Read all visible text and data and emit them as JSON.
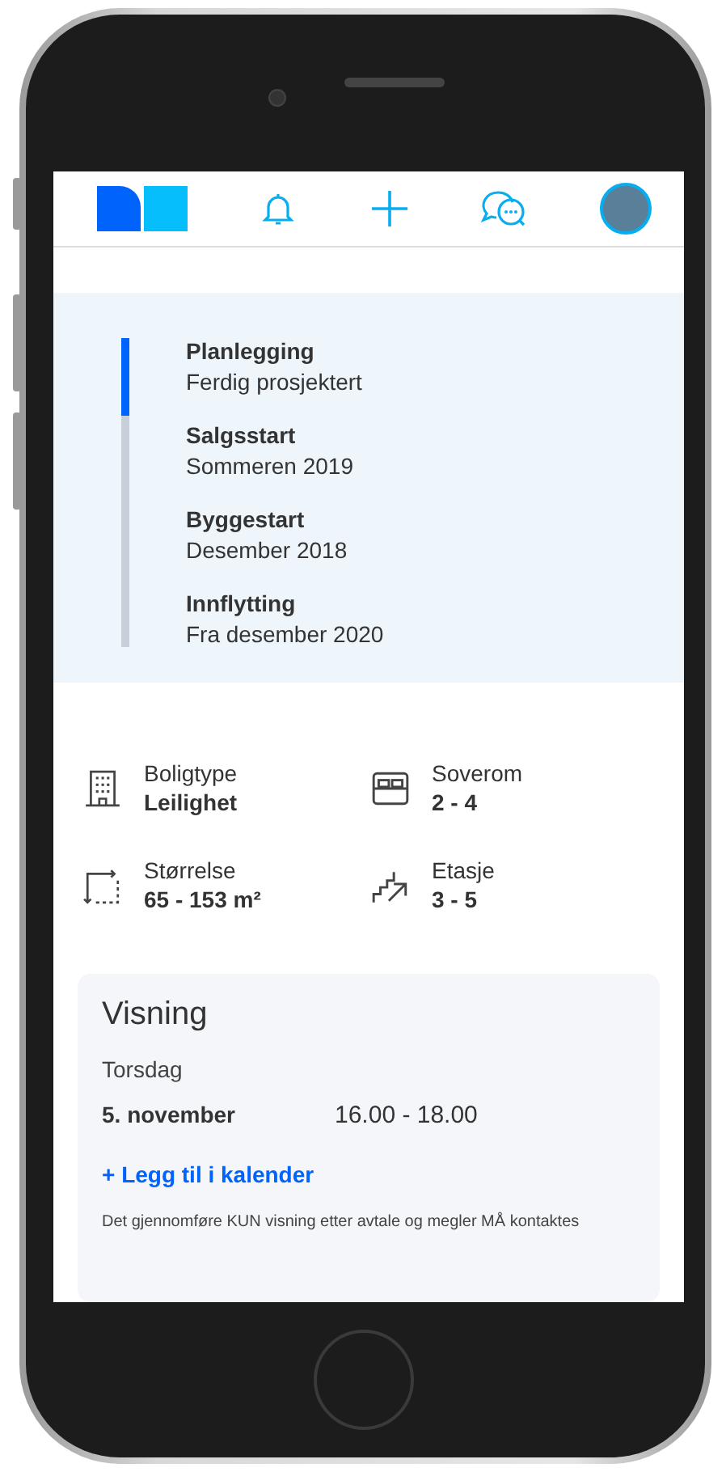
{
  "timeline": {
    "steps": [
      {
        "title": "Planlegging",
        "detail": "Ferdig prosjektert",
        "done": true
      },
      {
        "title": "Salgsstart",
        "detail": "Sommeren 2019",
        "done": false
      },
      {
        "title": "Byggestart",
        "detail": "Desember 2018",
        "done": false
      },
      {
        "title": "Innflytting",
        "detail": "Fra desember 2020",
        "done": false
      }
    ]
  },
  "facts": [
    {
      "kind": "building",
      "label": "Boligtype",
      "value": "Leilighet"
    },
    {
      "kind": "bed",
      "label": "Soverom",
      "value": "2 - 4"
    },
    {
      "kind": "area",
      "label": "Størrelse",
      "value": "65 - 153 m²"
    },
    {
      "kind": "stairs",
      "label": "Etasje",
      "value": "3 - 5"
    }
  ],
  "viewing": {
    "title": "Visning",
    "day": "Torsdag",
    "date": "5. november",
    "time": "16.00 - 18.00",
    "link": "+ Legg til i kalender",
    "note": "Det gjennomføre KUN visning etter avtale og megler MÅ kontaktes"
  }
}
